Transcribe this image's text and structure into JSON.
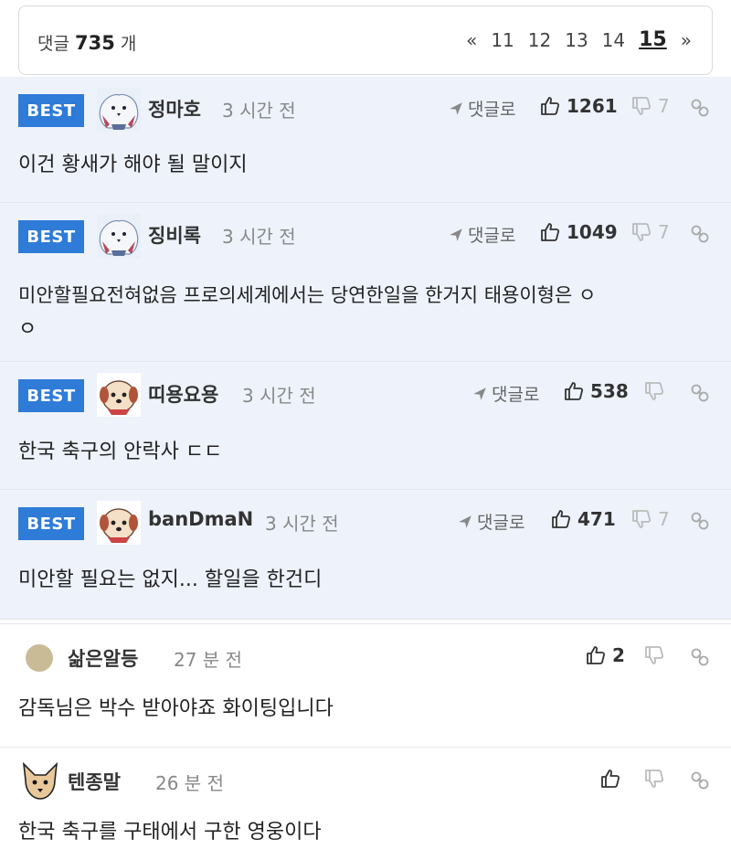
{
  "header": {
    "count_label": "댓글",
    "count_value": "735",
    "count_unit": "개",
    "pager": {
      "prev": "«",
      "pages": [
        "11",
        "12",
        "13",
        "14",
        "15"
      ],
      "current": "15",
      "next": "»"
    }
  },
  "labels": {
    "best_badge": "BEST",
    "reply": "댓글로"
  },
  "colors": {
    "best_bg": "#edf2fb",
    "badge": "#2e7bd8"
  },
  "comments": [
    {
      "best": true,
      "nick": "정마호",
      "time": "3 시간 전",
      "up": "1261",
      "down": "7",
      "avatar": "bear-avatar",
      "text": "이건 황새가 해야 될 말이지"
    },
    {
      "best": true,
      "nick": "징비록",
      "time": "3 시간 전",
      "up": "1049",
      "down": "7",
      "avatar": "bear-avatar",
      "text_line1": "미안할필요전혀없음 프로의세계에서는 당연한일을 한거지 태용이형은 ㅇ",
      "text_line2": "ㅇ"
    },
    {
      "best": true,
      "nick": "띠용요용",
      "time": "3 시간 전",
      "up": "538",
      "down": "",
      "avatar": "dog-avatar",
      "text": "한국 축구의 안락사 ㄷㄷ"
    },
    {
      "best": true,
      "nick": "banDmaN",
      "time": "3 시간 전",
      "up": "471",
      "down": "7",
      "avatar": "dog-avatar",
      "text": "미안할 필요는 없지... 할일을 한건디"
    },
    {
      "best": false,
      "nick": "삶은알등",
      "time": "27 분 전",
      "up": "2",
      "down": "",
      "avatar": "circle-avatar",
      "text": "감독님은 박수 받아야죠 화이팅입니다"
    },
    {
      "best": false,
      "nick": "텐종말",
      "time": "26 분 전",
      "up": "",
      "down": "",
      "avatar": "chihuahua-avatar",
      "text": "한국 축구를 구태에서 구한 영웅이다"
    }
  ]
}
